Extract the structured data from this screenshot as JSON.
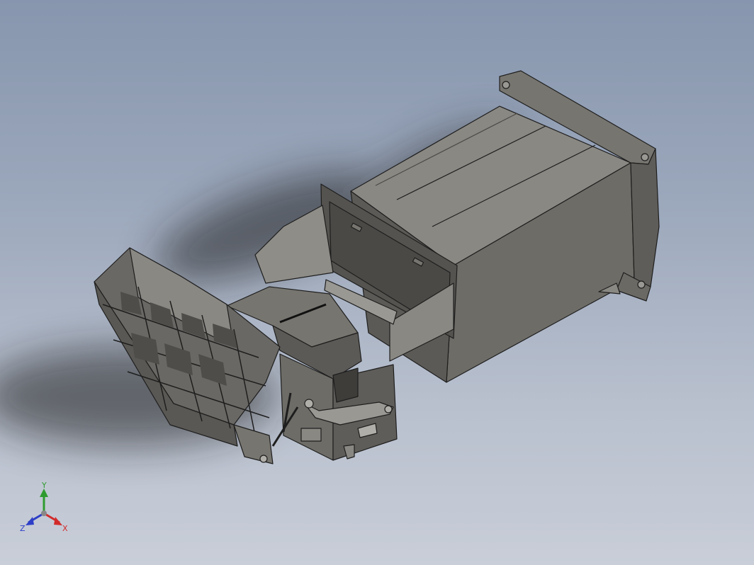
{
  "viewport": {
    "background_top": "#8796ae",
    "background_bottom": "#c9ced8",
    "model_fill": "#6f6d68",
    "model_light": "#8c8a84",
    "model_dark": "#4a4946",
    "edge_color": "#1e1e1e"
  },
  "triad": {
    "x_label": "X",
    "y_label": "Y",
    "z_label": "Z",
    "x_color": "#d12b2b",
    "y_color": "#2f9b2f",
    "z_color": "#2d3ec7"
  }
}
